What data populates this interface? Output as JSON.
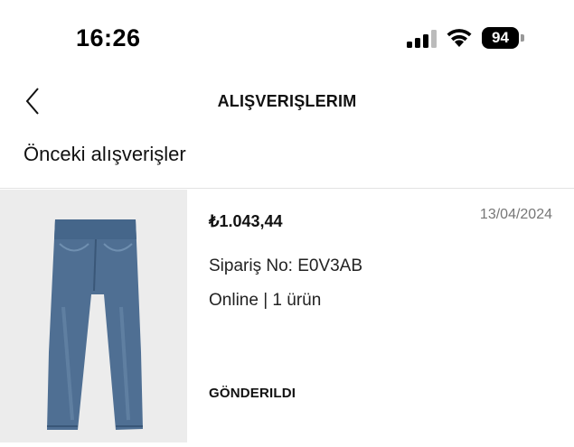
{
  "status_bar": {
    "time": "16:26",
    "battery": "94"
  },
  "nav": {
    "title": "ALIŞVERIŞLERIM",
    "back_icon": "chevron-left-icon"
  },
  "section_title": "Önceki alışverişler",
  "order": {
    "price": "₺1.043,44",
    "date": "13/04/2024",
    "order_no": "Sipariş No: E0V3AB",
    "channel_items": "Online | 1 ürün",
    "status": "GÖNDERILDI",
    "image": "jeans-product-image"
  }
}
